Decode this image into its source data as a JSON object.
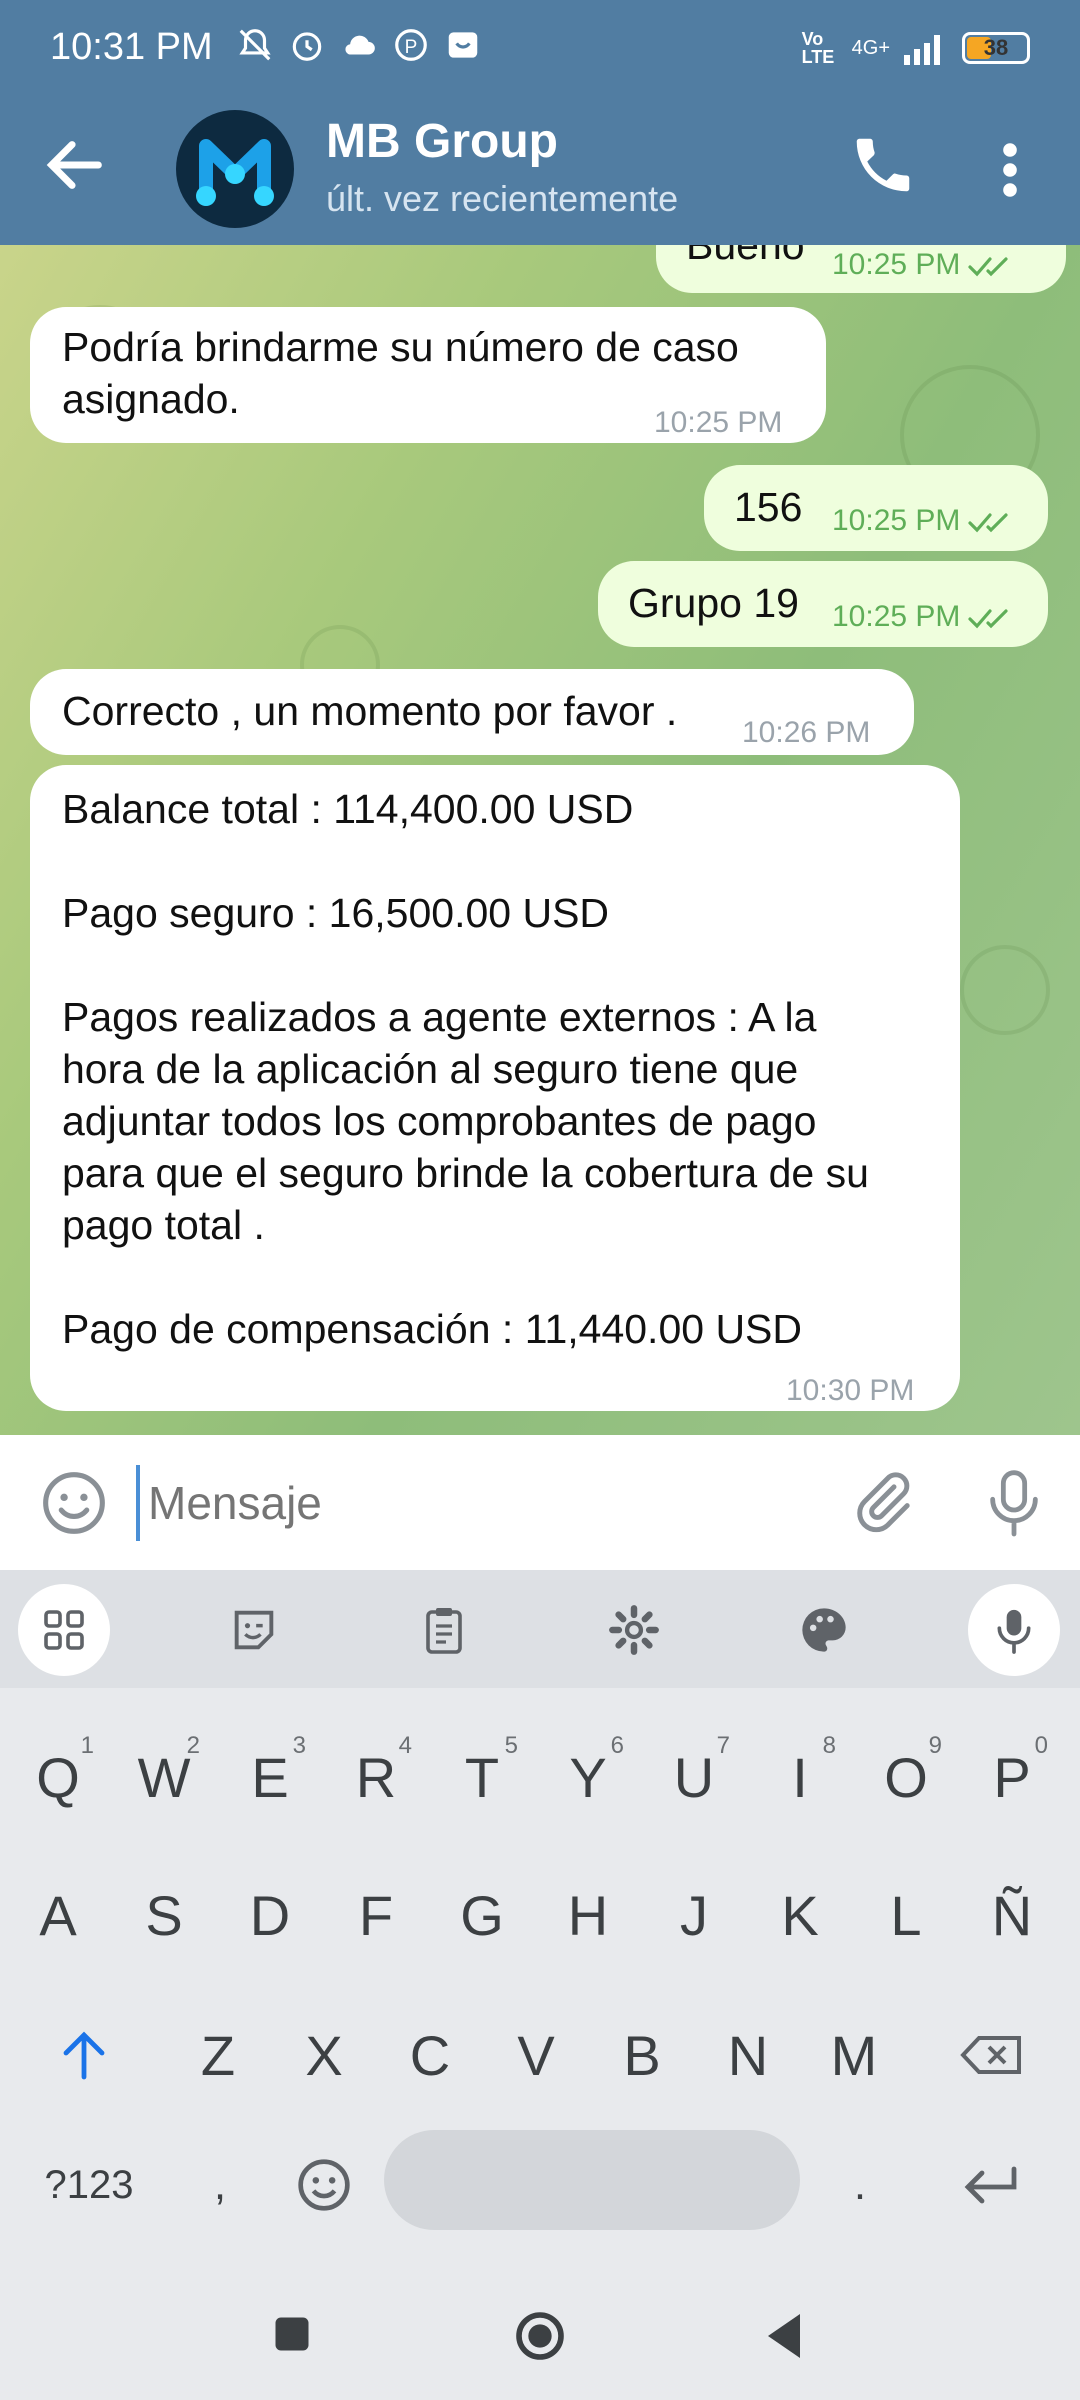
{
  "status_bar": {
    "time": "10:31 PM",
    "battery": "38",
    "network": "4G+",
    "volte": "Vo LTE",
    "icons": [
      "mute-icon",
      "alarm-icon",
      "cloud-icon",
      "app-icon",
      "notification-icon",
      "signal-icon",
      "battery-icon"
    ]
  },
  "header": {
    "title": "MB Group",
    "subtitle": "últ. vez recientemente"
  },
  "messages": [
    {
      "direction": "out",
      "text": "Bueno",
      "time": "10:25 PM",
      "read": true
    },
    {
      "direction": "in",
      "text": "Podría brindarme su número de caso asignado.",
      "time": "10:25 PM"
    },
    {
      "direction": "out",
      "text": "156",
      "time": "10:25 PM",
      "read": true
    },
    {
      "direction": "out",
      "text": "Grupo 19",
      "time": "10:25 PM",
      "read": true
    },
    {
      "direction": "in",
      "text": "Correcto , un momento por favor .",
      "time": "10:26 PM"
    },
    {
      "direction": "in",
      "lines": [
        "Balance total : 114,400.00 USD",
        "",
        "Pago seguro : 16,500.00 USD",
        "",
        "Pagos realizados a agente externos : A la",
        "hora de la aplicación al seguro tiene que",
        "adjuntar todos los comprobantes de pago",
        "para que el seguro brinde la cobertura de su",
        "pago total .",
        "",
        "Pago de compensación : 11,440.00 USD"
      ],
      "time": "10:30 PM"
    }
  ],
  "input": {
    "placeholder": "Mensaje"
  },
  "keyboard": {
    "row1": [
      {
        "k": "Q",
        "n": "1"
      },
      {
        "k": "W",
        "n": "2"
      },
      {
        "k": "E",
        "n": "3"
      },
      {
        "k": "R",
        "n": "4"
      },
      {
        "k": "T",
        "n": "5"
      },
      {
        "k": "Y",
        "n": "6"
      },
      {
        "k": "U",
        "n": "7"
      },
      {
        "k": "I",
        "n": "8"
      },
      {
        "k": "O",
        "n": "9"
      },
      {
        "k": "P",
        "n": "0"
      }
    ],
    "row2": [
      "A",
      "S",
      "D",
      "F",
      "G",
      "H",
      "J",
      "K",
      "L",
      "Ñ"
    ],
    "row3": [
      "Z",
      "X",
      "C",
      "V",
      "B",
      "N",
      "M"
    ],
    "symbols_label": "?123",
    "comma": ",",
    "period": "."
  },
  "colors": {
    "header": "#517da2",
    "incoming_bubble": "#ffffff",
    "outgoing_bubble": "#effedd",
    "check": "#5fae58",
    "accent": "#4a8fd6"
  }
}
